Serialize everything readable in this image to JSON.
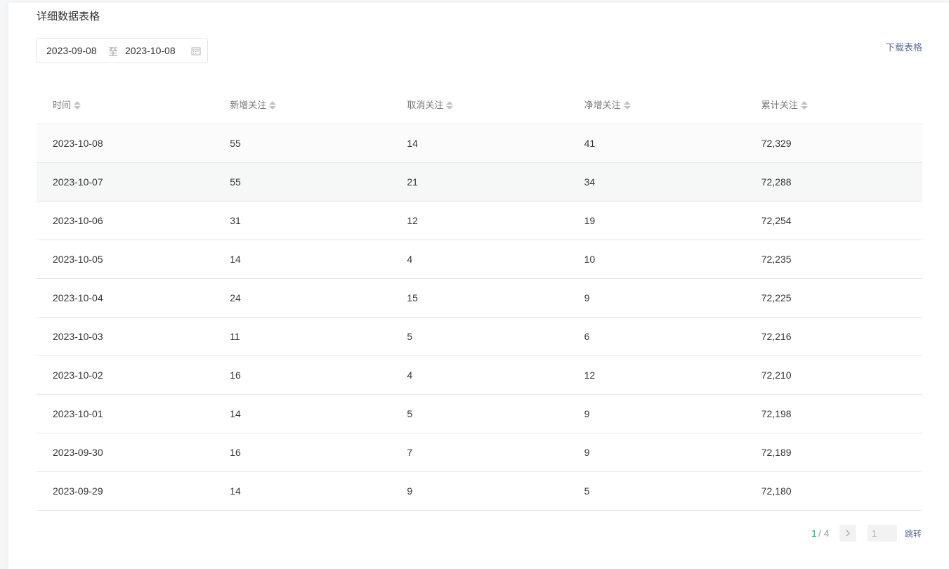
{
  "section": {
    "title": "详细数据表格",
    "download_label": "下载表格"
  },
  "date_range": {
    "start": "2023-09-08",
    "separator": "至",
    "end": "2023-10-08",
    "icon": "calendar-icon"
  },
  "table": {
    "columns": [
      "时间",
      "新增关注",
      "取消关注",
      "净增关注",
      "累计关注"
    ],
    "sort_icon": "sort-icon",
    "rows": [
      [
        "2023-10-08",
        "55",
        "14",
        "41",
        "72,329"
      ],
      [
        "2023-10-07",
        "55",
        "21",
        "34",
        "72,288"
      ],
      [
        "2023-10-06",
        "31",
        "12",
        "19",
        "72,254"
      ],
      [
        "2023-10-05",
        "14",
        "4",
        "10",
        "72,235"
      ],
      [
        "2023-10-04",
        "24",
        "15",
        "9",
        "72,225"
      ],
      [
        "2023-10-03",
        "11",
        "5",
        "6",
        "72,216"
      ],
      [
        "2023-10-02",
        "16",
        "4",
        "12",
        "72,210"
      ],
      [
        "2023-10-01",
        "14",
        "5",
        "9",
        "72,198"
      ],
      [
        "2023-09-30",
        "16",
        "7",
        "9",
        "72,189"
      ],
      [
        "2023-09-29",
        "14",
        "9",
        "5",
        "72,180"
      ]
    ]
  },
  "pagination": {
    "current": "1",
    "total_text": "/ 4",
    "jump_placeholder": "1",
    "jump_label": "跳转",
    "next_icon": "chevron-right-icon"
  },
  "colors": {
    "accent_green": "#07c160",
    "link_blue": "#576b95",
    "text": "#353535",
    "muted": "#9a9a9a"
  }
}
